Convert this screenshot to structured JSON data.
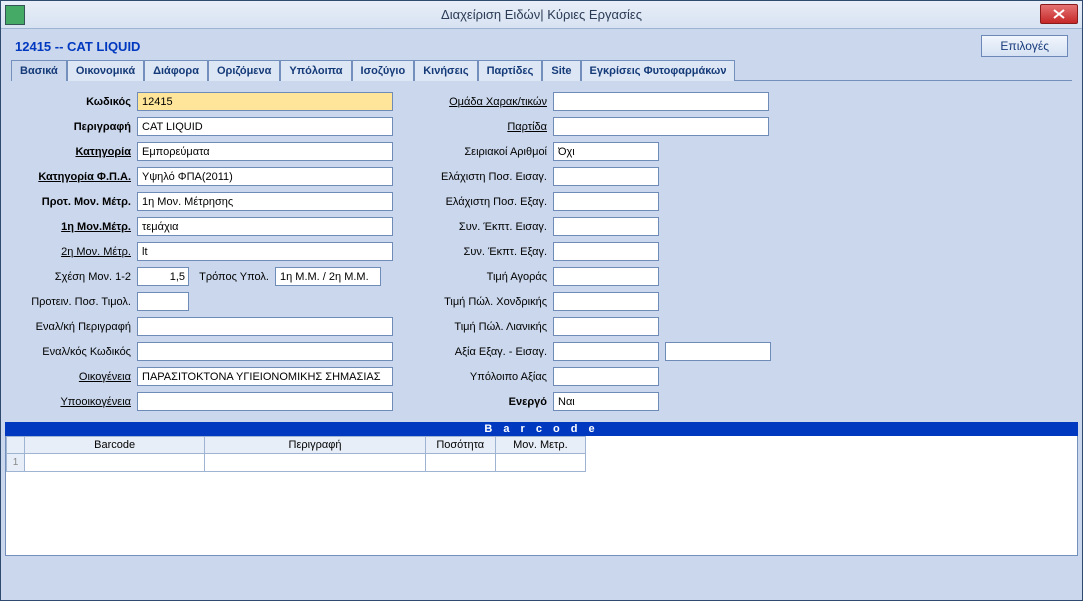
{
  "window": {
    "title": "Διαχείριση Ειδών| Κύριες Εργασίες"
  },
  "header": {
    "item_title": "12415 -- CAT LIQUID",
    "options_btn": "Επιλογές"
  },
  "tabs": [
    "Βασικά",
    "Οικονομικά",
    "Διάφορα",
    "Οριζόμενα",
    "Υπόλοιπα",
    "Ισοζύγιο",
    "Κινήσεις",
    "Παρτίδες",
    "Site",
    "Εγκρίσεις Φυτοφαρμάκων"
  ],
  "left": {
    "code_lbl": "Κωδικός",
    "code": "12415",
    "desc_lbl": "Περιγραφή",
    "desc": "CAT LIQUID",
    "cat_lbl": "Κατηγορία",
    "cat": "Εμπορεύματα",
    "vatcat_lbl": "Κατηγορία Φ.Π.Α.",
    "vatcat": "Υψηλό ΦΠΑ(2011)",
    "puom_lbl": "Προτ. Μον. Μέτρ.",
    "puom": "1η Μον. Μέτρησης",
    "uom1_lbl": "1η Μον.Μέτρ.",
    "uom1": "τεμάχια",
    "uom2_lbl": "2η Μον. Μέτρ.",
    "uom2": "lt",
    "rel_lbl": "Σχέση Μον. 1-2",
    "rel": "1,5",
    "calc_lbl": "Τρόπος Υπολ.",
    "calc": "1η Μ.Μ. / 2η Μ.Μ.",
    "sugqty_lbl": "Προτειν. Ποσ. Τιμολ.",
    "sugqty": "",
    "altdesc_lbl": "Εναλ/κή Περιγραφή",
    "altdesc": "",
    "altcode_lbl": "Εναλ/κός Κωδικός",
    "altcode": "",
    "family_lbl": "Οικογένεια",
    "family": "ΠΑΡΑΣΙΤΟΚΤΟΝΑ ΥΓΙΕΙΟΝΟΜΙΚΗΣ ΣΗΜΑΣΙΑΣ",
    "subfamily_lbl": "Υποοικογένεια",
    "subfamily": ""
  },
  "right": {
    "chargrp_lbl": "Ομάδα Χαρακ/τικών",
    "chargrp": "",
    "lot_lbl": "Παρτίδα",
    "lot": "",
    "serial_lbl": "Σειριακοί Αριθμοί",
    "serial": "Όχι",
    "minimp_lbl": "Ελάχιστη Ποσ. Εισαγ.",
    "minimp": "",
    "minexp_lbl": "Ελάχιστη Ποσ. Εξαγ.",
    "minexp": "",
    "discimp_lbl": "Συν. Έκπτ. Εισαγ.",
    "discimp": "",
    "discexp_lbl": "Συν. Έκπτ. Εξαγ.",
    "discexp": "",
    "buyprice_lbl": "Τιμή Αγοράς",
    "buyprice": "",
    "wholesale_lbl": "Τιμή Πώλ. Χονδρικής",
    "wholesale": "",
    "retail_lbl": "Τιμή Πώλ. Λιανικής",
    "retail": "",
    "expimpval_lbl": "Αξία Εξαγ. - Εισαγ.",
    "expimpval": "",
    "expimpval2": "",
    "balval_lbl": "Υπόλοιπο Αξίας",
    "balval": "",
    "active_lbl": "Ενεργό",
    "active": "Ναι"
  },
  "barcode": {
    "title": "B a r c o d e",
    "cols": [
      "Barcode",
      "Περιγραφή",
      "Ποσότητα",
      "Μον. Μετρ."
    ],
    "rownum": "1"
  }
}
